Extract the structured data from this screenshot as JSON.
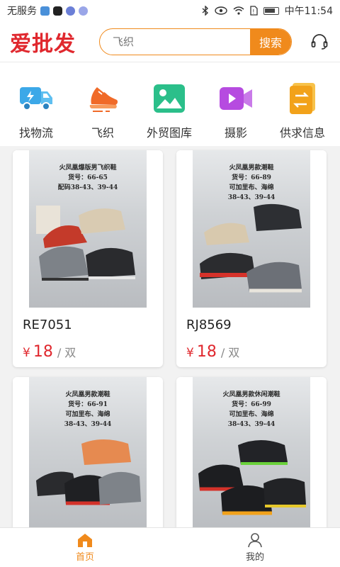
{
  "status_bar": {
    "carrier": "无服务",
    "time": "中午11:54"
  },
  "header": {
    "logo": "爱批发",
    "search": {
      "value": "",
      "placeholder": "飞织",
      "button_label": "搜索"
    }
  },
  "categories": [
    {
      "label": "找物流",
      "icon": "truck-icon",
      "color": "#3ca8e8"
    },
    {
      "label": "飞织",
      "icon": "sneaker-icon",
      "color": "#f06a28"
    },
    {
      "label": "外贸图库",
      "icon": "image-gallery-icon",
      "color": "#2bbf8a"
    },
    {
      "label": "摄影",
      "icon": "video-camera-icon",
      "color": "#b64be0"
    },
    {
      "label": "供求信息",
      "icon": "document-exchange-icon",
      "color": "#f2a21a"
    }
  ],
  "products": [
    {
      "code": "RE7051",
      "price_symbol": "¥",
      "price": "18",
      "unit": "/ 双",
      "photo_lines": [
        "火凤凰爆版男飞织鞋",
        "货号：66-65",
        "配码38-43、39-44"
      ]
    },
    {
      "code": "RJ8569",
      "price_symbol": "¥",
      "price": "18",
      "unit": "/ 双",
      "photo_lines": [
        "火凤凰男款潮鞋",
        "货号：66-89",
        "可加里布、海绵",
        "38-43、39-44"
      ]
    },
    {
      "code": "",
      "price_symbol": "",
      "price": "",
      "unit": "",
      "photo_lines": [
        "火凤凰男款潮鞋",
        "货号：66-91",
        "可加里布、海绵",
        "38-43、39-44"
      ]
    },
    {
      "code": "",
      "price_symbol": "",
      "price": "",
      "unit": "",
      "photo_lines": [
        "火凤凰男款休闲潮鞋",
        "货号：66-99",
        "可加里布、海绵",
        "38-43、39-44"
      ]
    }
  ],
  "bottom_nav": [
    {
      "label": "首页",
      "icon": "home-icon",
      "active": true
    },
    {
      "label": "我的",
      "icon": "user-icon",
      "active": false
    }
  ],
  "colors": {
    "accent": "#f08a1c",
    "brand": "#e0282e",
    "price": "#e0282e"
  }
}
